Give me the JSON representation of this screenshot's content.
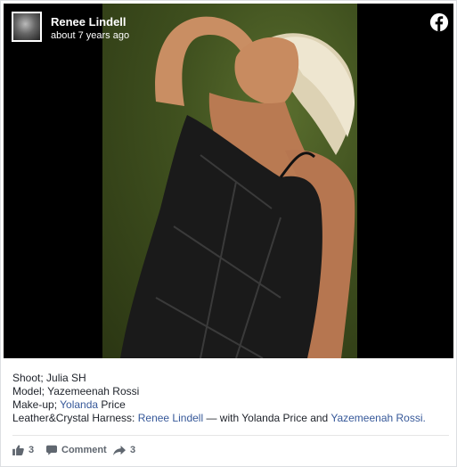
{
  "post": {
    "author": "Renee Lindell",
    "timestamp": "about 7 years ago",
    "icons": {
      "avatar": "profile-avatar",
      "brand": "facebook-logo-icon"
    }
  },
  "caption": {
    "line1": "Shoot; Julia SH",
    "line2": "Model; Yazemeenah Rossi",
    "line3_prefix": "Make-up; ",
    "line3_link": "Yolanda",
    "line3_suffix": " Price",
    "line4_prefix": "Leather&Crystal Harness: ",
    "line4_link1": "Renee Lindell",
    "line4_middle": " — with Yolanda Price and ",
    "line4_link2": "Yazemeenah Rossi."
  },
  "actions": {
    "likes_count": "3",
    "comment_label": "Comment",
    "shares_count": "3",
    "icons": [
      "thumbs-up-icon",
      "comment-icon",
      "share-icon"
    ]
  },
  "colors": {
    "link": "#365899",
    "text": "#1d2129",
    "muted": "#606770",
    "brand": "#ffffff"
  }
}
